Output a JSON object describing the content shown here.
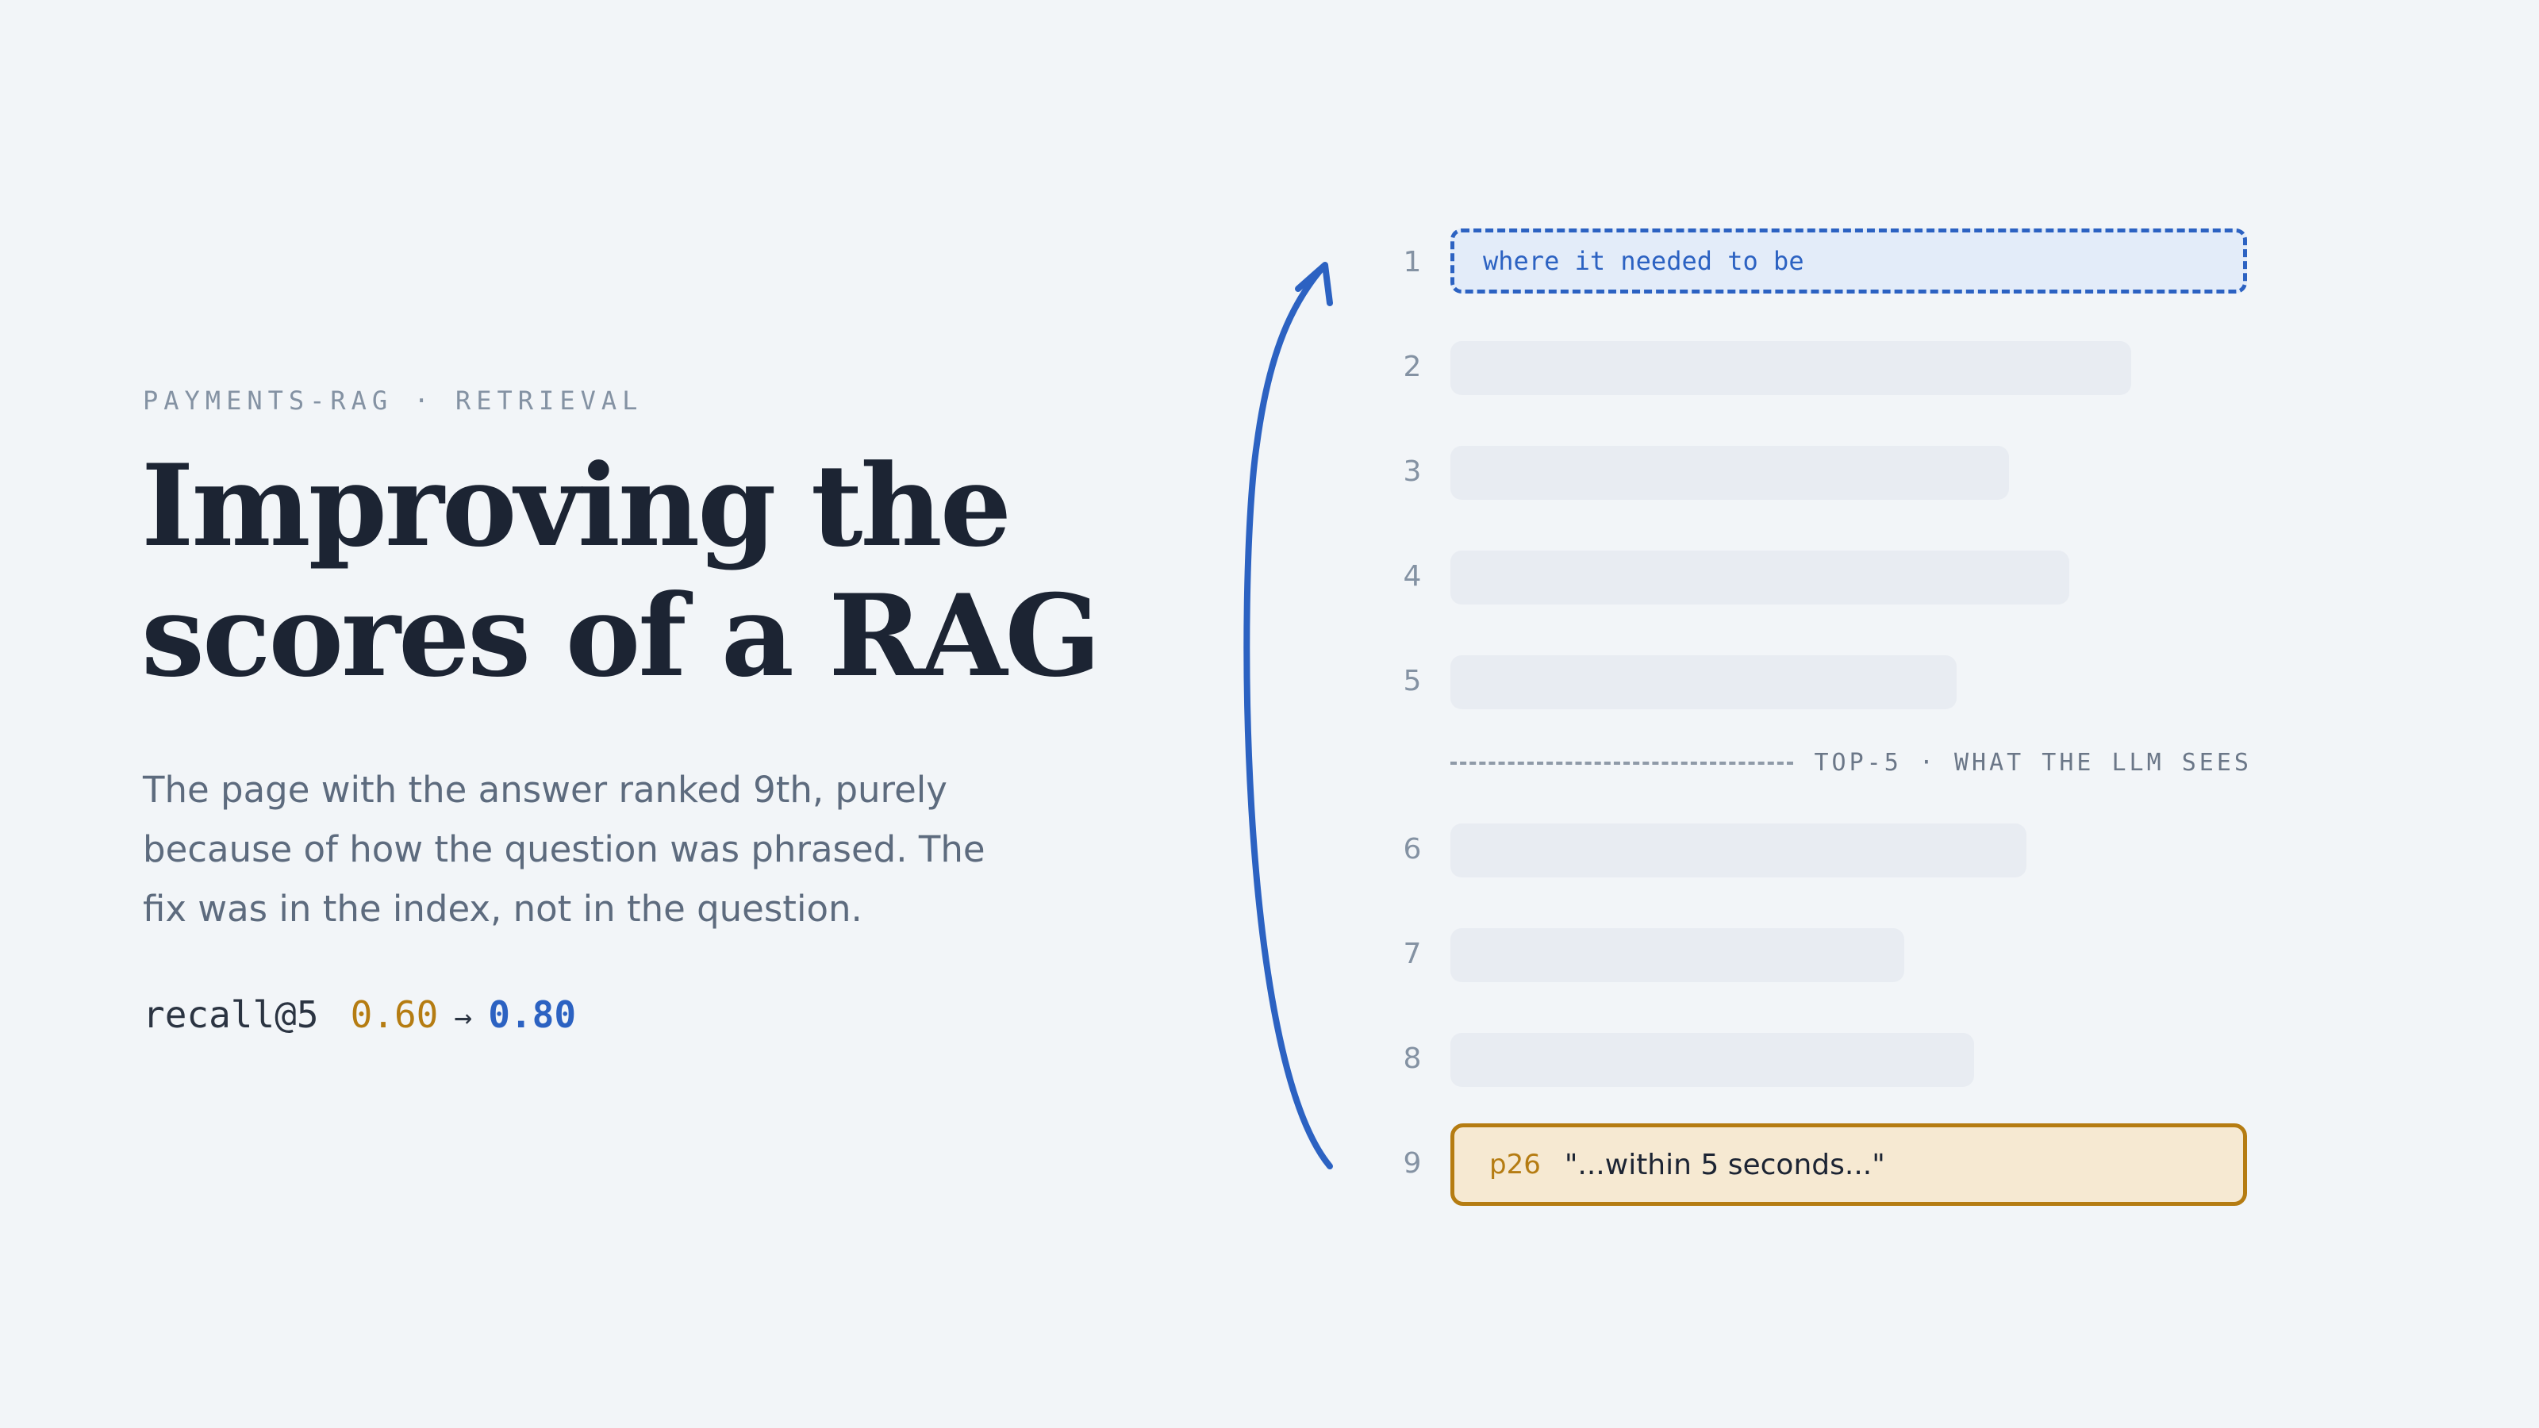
{
  "eyebrow": "PAYMENTS-RAG · RETRIEVAL",
  "title": {
    "line1": "Improving the",
    "line2": "scores of a RAG"
  },
  "description": {
    "line1": "The page with the answer ranked 9th, purely",
    "line2": "because of how the question was phrased. The",
    "line3": "fix was in the index, not in the question."
  },
  "metric": {
    "label": "recall@5",
    "before": "0.60",
    "arrow": "→",
    "after": "0.80"
  },
  "ranking": {
    "target_label": "where it needed to be",
    "divider_label": "TOP-5 · WHAT THE LLM SEES",
    "ranks": [
      "1",
      "2",
      "3",
      "4",
      "5",
      "6",
      "7",
      "8",
      "9"
    ],
    "hit": {
      "page": "p26",
      "quote": "\"...within 5 seconds...\""
    }
  },
  "colors": {
    "background": "#f2f5f8",
    "target_blue": "#2c62c2",
    "hit_amber": "#b57c12",
    "placeholder_bar": "#e8ecf2"
  }
}
